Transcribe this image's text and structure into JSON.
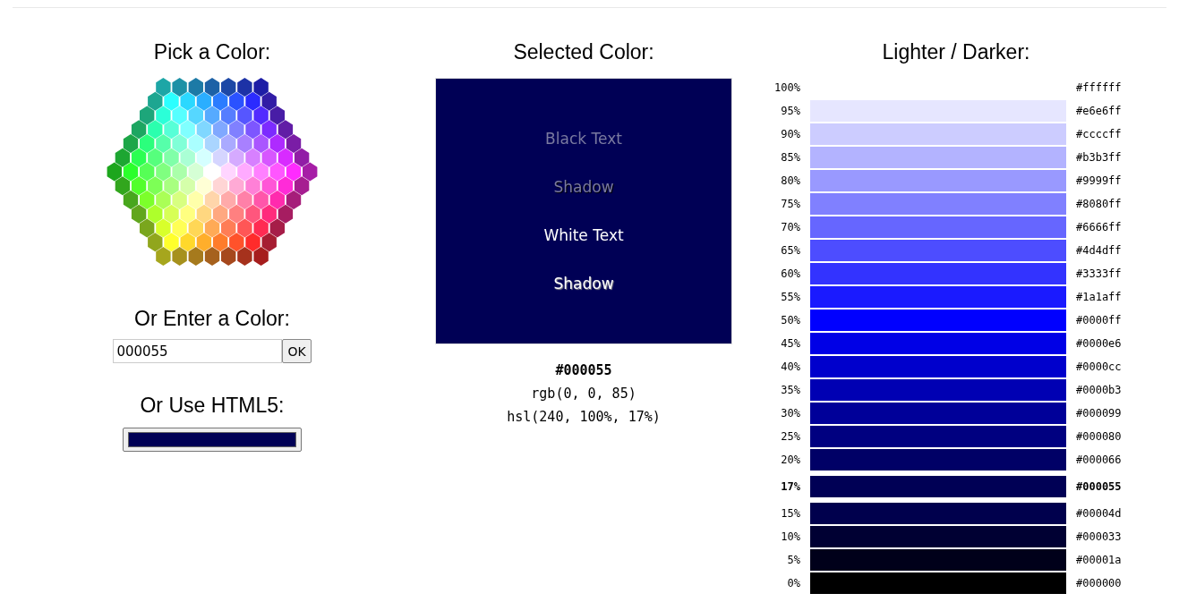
{
  "picker": {
    "title": "Pick a Color:"
  },
  "entry": {
    "title": "Or Enter a Color:",
    "value": "000055",
    "button": "OK"
  },
  "html5": {
    "title": "Or Use HTML5:",
    "color": "#000055"
  },
  "selected": {
    "title": "Selected Color:",
    "color": "#000055",
    "samples": [
      {
        "text": "Black Text",
        "kind": "dark"
      },
      {
        "text": "Shadow",
        "kind": "dark-shadow"
      },
      {
        "text": "White Text",
        "kind": "light"
      },
      {
        "text": "Shadow",
        "kind": "light-shadow"
      }
    ],
    "hex": "#000055",
    "rgb": "rgb(0, 0, 85)",
    "hsl": "hsl(240, 100%, 17%)"
  },
  "shades": {
    "title": "Lighter / Darker:",
    "rows": [
      {
        "label": "100%",
        "color": "#ffffff",
        "hex": "#ffffff",
        "selected": false
      },
      {
        "label": "95%",
        "color": "#e6e6ff",
        "hex": "#e6e6ff",
        "selected": false
      },
      {
        "label": "90%",
        "color": "#ccccff",
        "hex": "#ccccff",
        "selected": false
      },
      {
        "label": "85%",
        "color": "#b3b3ff",
        "hex": "#b3b3ff",
        "selected": false
      },
      {
        "label": "80%",
        "color": "#9999ff",
        "hex": "#9999ff",
        "selected": false
      },
      {
        "label": "75%",
        "color": "#8080ff",
        "hex": "#8080ff",
        "selected": false
      },
      {
        "label": "70%",
        "color": "#6666ff",
        "hex": "#6666ff",
        "selected": false
      },
      {
        "label": "65%",
        "color": "#4d4dff",
        "hex": "#4d4dff",
        "selected": false
      },
      {
        "label": "60%",
        "color": "#3333ff",
        "hex": "#3333ff",
        "selected": false
      },
      {
        "label": "55%",
        "color": "#1a1aff",
        "hex": "#1a1aff",
        "selected": false
      },
      {
        "label": "50%",
        "color": "#0000ff",
        "hex": "#0000ff",
        "selected": false
      },
      {
        "label": "45%",
        "color": "#0000e6",
        "hex": "#0000e6",
        "selected": false
      },
      {
        "label": "40%",
        "color": "#0000cc",
        "hex": "#0000cc",
        "selected": false
      },
      {
        "label": "35%",
        "color": "#0000b3",
        "hex": "#0000b3",
        "selected": false
      },
      {
        "label": "30%",
        "color": "#000099",
        "hex": "#000099",
        "selected": false
      },
      {
        "label": "25%",
        "color": "#000080",
        "hex": "#000080",
        "selected": false
      },
      {
        "label": "20%",
        "color": "#000066",
        "hex": "#000066",
        "selected": false
      },
      {
        "label": "17%",
        "color": "#000055",
        "hex": "#000055",
        "selected": true
      },
      {
        "label": "15%",
        "color": "#00004d",
        "hex": "#00004d",
        "selected": false
      },
      {
        "label": "10%",
        "color": "#000033",
        "hex": "#000033",
        "selected": false
      },
      {
        "label": "5%",
        "color": "#00001a",
        "hex": "#00001a",
        "selected": false
      },
      {
        "label": "0%",
        "color": "#000000",
        "hex": "#000000",
        "selected": false
      }
    ]
  }
}
